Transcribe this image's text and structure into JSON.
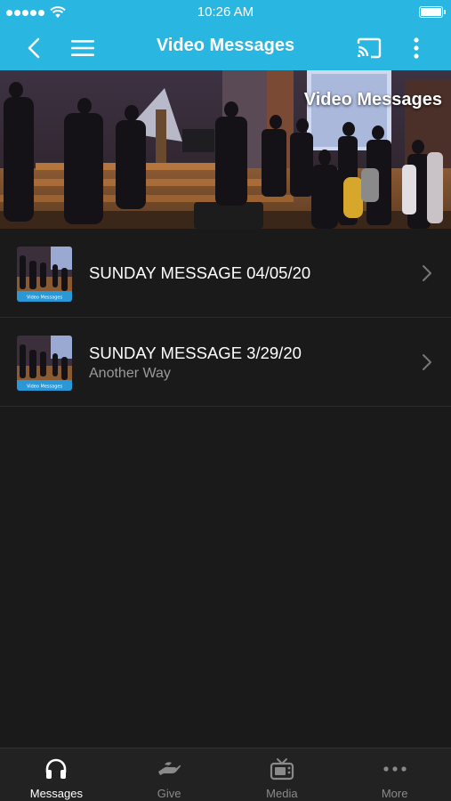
{
  "status_bar": {
    "time": "10:26 AM"
  },
  "nav": {
    "title": "Video Messages"
  },
  "hero": {
    "title": "Video Messages"
  },
  "list": [
    {
      "title": "SUNDAY MESSAGE 04/05/20",
      "subtitle": ""
    },
    {
      "title": "SUNDAY MESSAGE 3/29/20",
      "subtitle": "Another Way"
    }
  ],
  "thumbnail_caption": "Video Messages",
  "tabs": [
    {
      "label": "Messages",
      "icon": "headphones-icon",
      "active": true
    },
    {
      "label": "Give",
      "icon": "giving-hand-icon",
      "active": false
    },
    {
      "label": "Media",
      "icon": "tv-icon",
      "active": false
    },
    {
      "label": "More",
      "icon": "more-dots-icon",
      "active": false
    }
  ],
  "colors": {
    "accent": "#29b6e0",
    "background": "#1a1a1a",
    "tab_bar": "#222222"
  }
}
